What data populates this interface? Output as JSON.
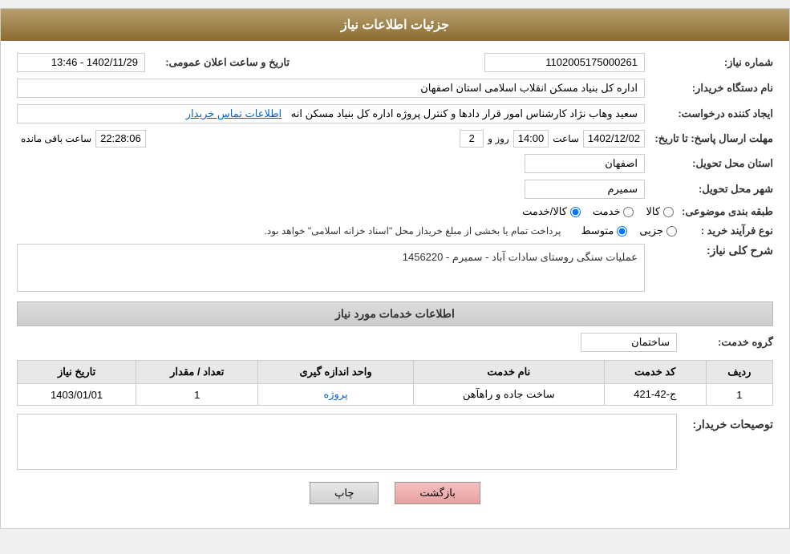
{
  "page": {
    "title": "جزئیات اطلاعات نیاز"
  },
  "header": {
    "shamare_label": "شماره نیاز:",
    "shamare_value": "1102005175000261",
    "tarikh_label": "تاریخ و ساعت اعلان عمومی:",
    "tarikh_value": "1402/11/29 - 13:46",
    "name_darkhast_label": "نام دستگاه خریدار:",
    "name_darkhast_value": "اداره کل بنیاد مسکن انقلاب اسلامی استان اصفهان",
    "ijad_label": "ایجاد کننده درخواست:",
    "ijad_value": "سعید وهاب نژاد کارشناس امور قرار دادها و کنترل  پروژه اداره کل بنیاد مسکن انه",
    "ijad_link": "اطلاعات تماس خریدار",
    "mohlat_label": "مهلت ارسال پاسخ: تا تاریخ:",
    "date_value": "1402/12/02",
    "saat_label": "ساعت",
    "saat_value": "14:00",
    "rooz_label": "روز و",
    "rooz_value": "2",
    "baghimande_value": "22:28:06",
    "baghimande_label": "ساعت باقی مانده",
    "ostan_label": "استان محل تحویل:",
    "ostan_value": "اصفهان",
    "shahr_label": "شهر محل تحویل:",
    "shahr_value": "سمیرم",
    "tabaqebandi_label": "طبقه بندی موضوعی:",
    "radio_options": [
      {
        "id": "kala",
        "label": "کالا",
        "checked": false
      },
      {
        "id": "khadamat",
        "label": "خدمت",
        "checked": false
      },
      {
        "id": "kala_khadamat",
        "label": "کالا/خدمت",
        "checked": true
      }
    ],
    "nooe_label": "نوع فرآیند خرید :",
    "proc_options": [
      {
        "id": "jozii",
        "label": "جزیی",
        "checked": false
      },
      {
        "id": "motavaset",
        "label": "متوسط",
        "checked": true
      }
    ],
    "proc_note": "پرداخت تمام یا بخشی از مبلغ خریداز محل \"اسناد خزانه اسلامی\" خواهد بود.",
    "sharh_label": "شرح کلی نیاز:",
    "sharh_value": "عملیات سنگی روستای سادات آباد - سمیرم - 1456220",
    "services_header": "اطلاعات خدمات مورد نیاز",
    "group_label": "گروه خدمت:",
    "group_value": "ساختمان",
    "table_headers": [
      "ردیف",
      "کد خدمت",
      "نام خدمت",
      "واحد اندازه گیری",
      "تعداد / مقدار",
      "تاریخ نیاز"
    ],
    "table_rows": [
      {
        "radif": "1",
        "kod": "ج-42-421",
        "name": "ساخت جاده و راهآهن",
        "vahed": "پروژه",
        "tedad": "1",
        "tarikh": "1403/01/01"
      }
    ],
    "buyer_desc_label": "توصیحات خریدار:",
    "buyer_desc_value": "",
    "btn_back": "بازگشت",
    "btn_print": "چاپ"
  }
}
